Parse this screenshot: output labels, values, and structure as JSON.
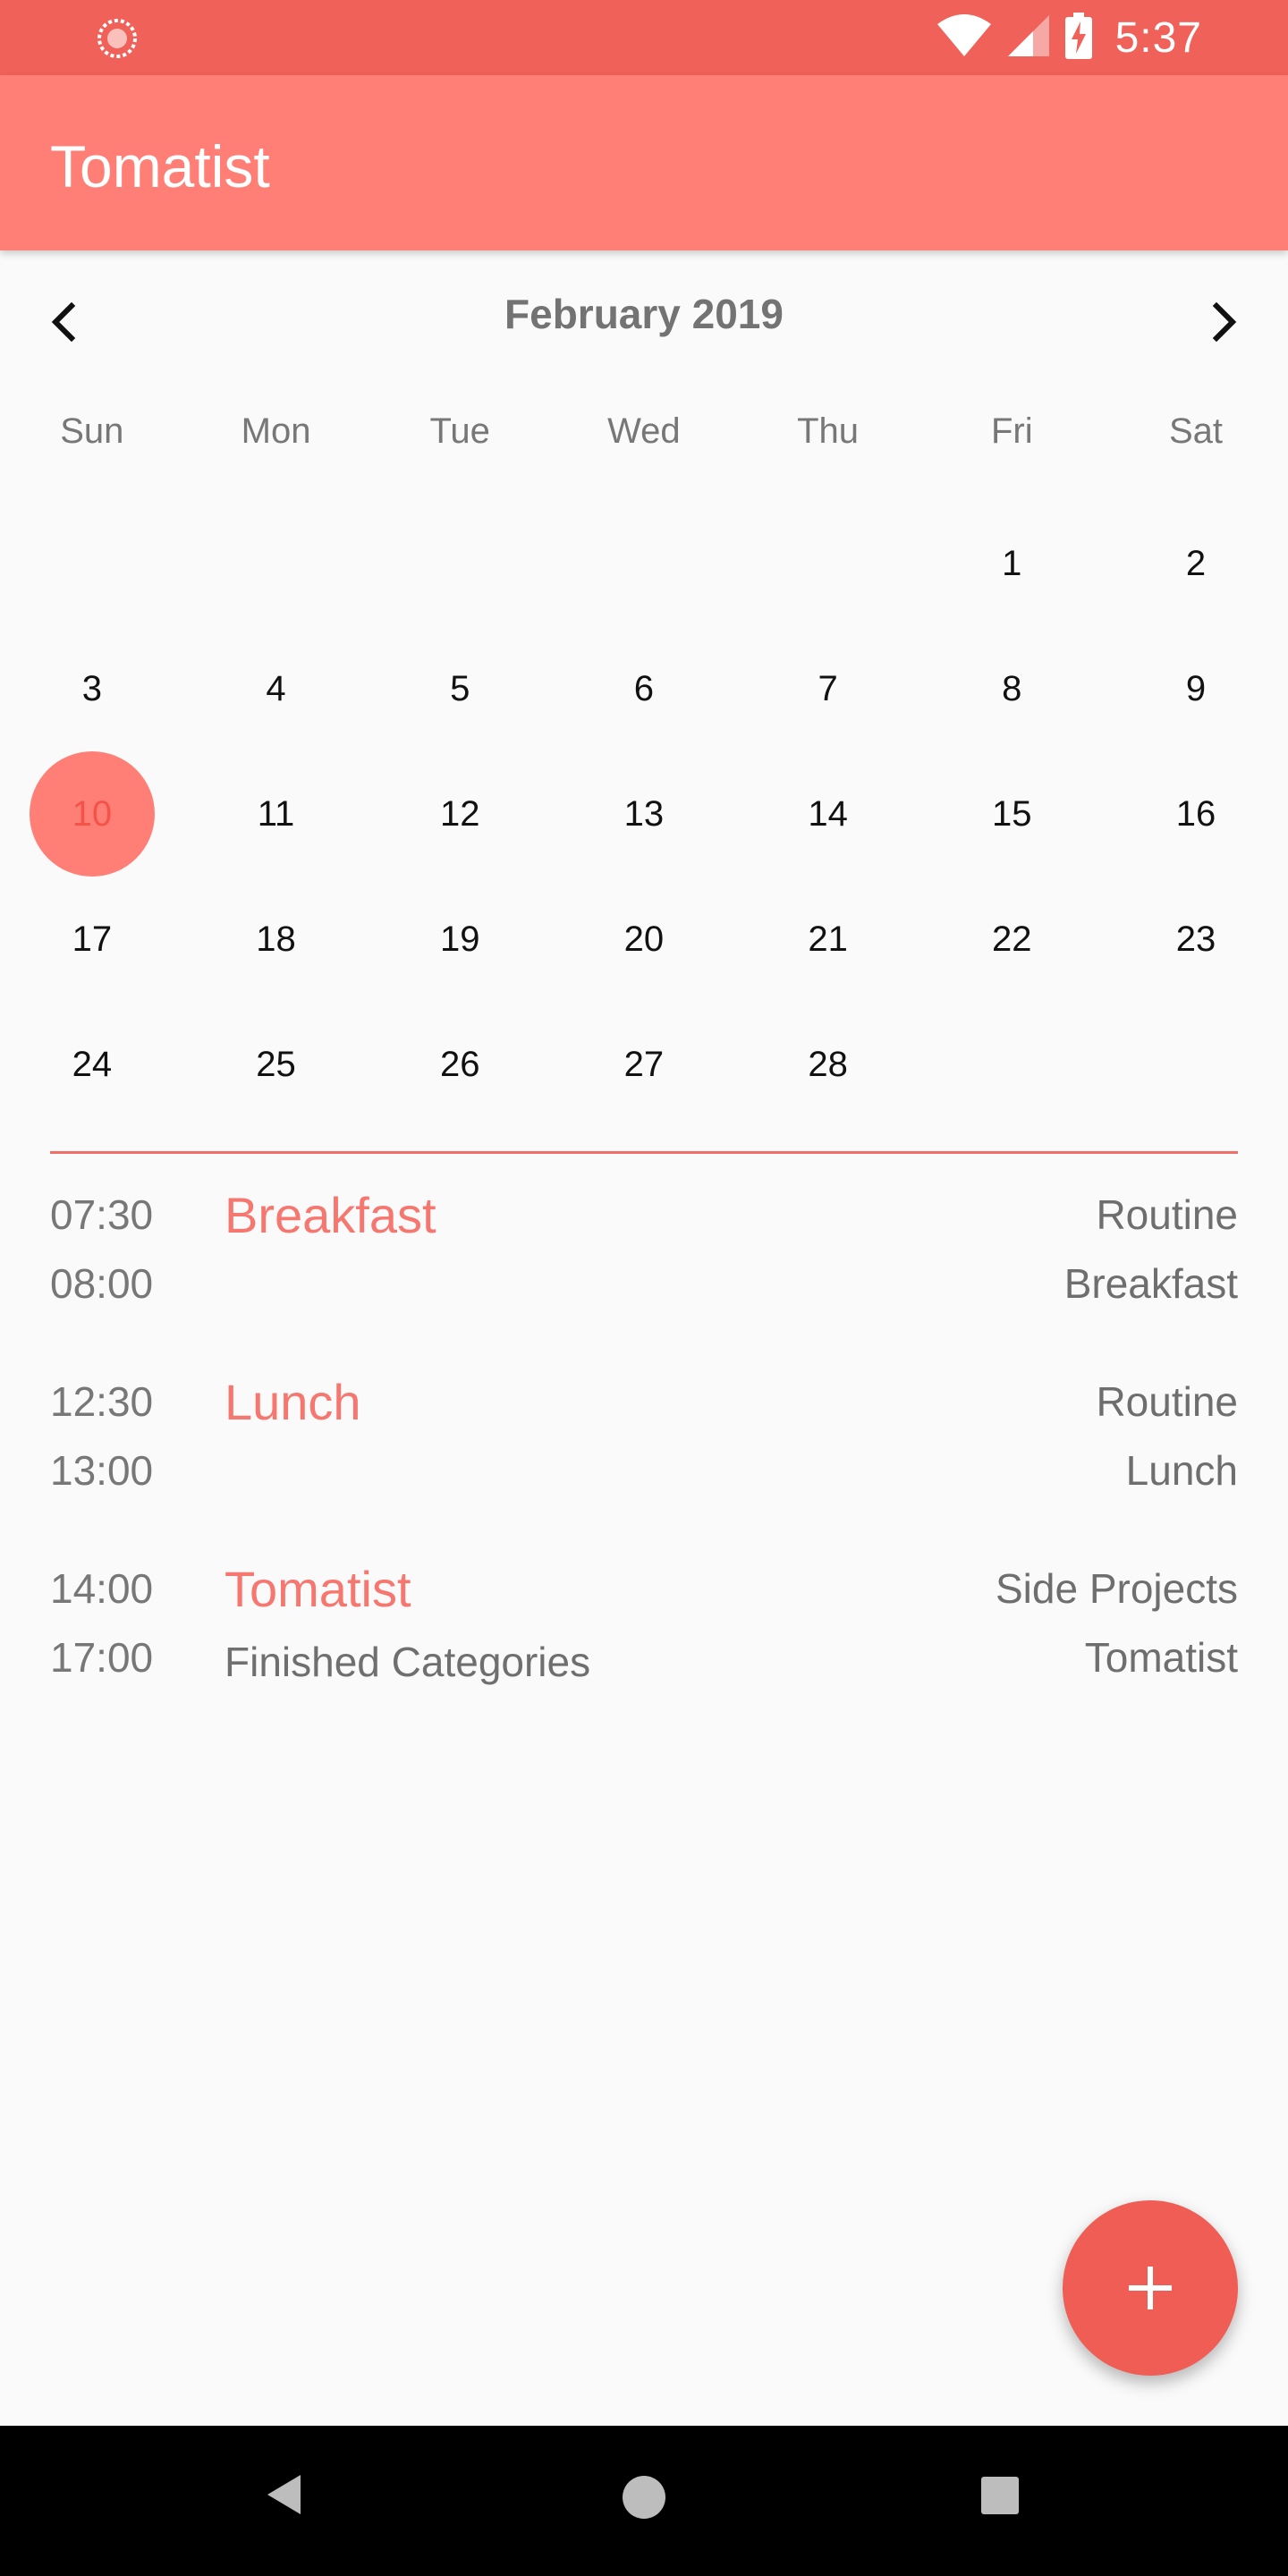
{
  "status_bar": {
    "time": "5:37",
    "icons": [
      "app-notification-icon",
      "wifi-icon",
      "cellular-signal-icon",
      "battery-charging-icon"
    ]
  },
  "app_bar": {
    "title": "Tomatist"
  },
  "calendar": {
    "month_title": "February 2019",
    "prev_icon": "chevron-left-icon",
    "next_icon": "chevron-right-icon",
    "weekdays": [
      "Sun",
      "Mon",
      "Tue",
      "Wed",
      "Thu",
      "Fri",
      "Sat"
    ],
    "days": [
      "",
      "",
      "",
      "",
      "",
      "1",
      "2",
      "3",
      "4",
      "5",
      "6",
      "7",
      "8",
      "9",
      "10",
      "11",
      "12",
      "13",
      "14",
      "15",
      "16",
      "17",
      "18",
      "19",
      "20",
      "21",
      "22",
      "23",
      "24",
      "25",
      "26",
      "27",
      "28",
      "",
      ""
    ],
    "selected_day": "10"
  },
  "events": [
    {
      "start": "07:30",
      "end": "08:00",
      "title": "Breakfast",
      "subtitle": "",
      "category": "Routine",
      "project": "Breakfast"
    },
    {
      "start": "12:30",
      "end": "13:00",
      "title": "Lunch",
      "subtitle": "",
      "category": "Routine",
      "project": "Lunch"
    },
    {
      "start": "14:00",
      "end": "17:00",
      "title": "Tomatist",
      "subtitle": "Finished Categories",
      "category": "Side Projects",
      "project": "Tomatist"
    }
  ],
  "fab": {
    "icon": "plus-icon"
  },
  "nav_bar": {
    "icons": [
      "back-icon",
      "home-icon",
      "recents-icon"
    ]
  },
  "colors": {
    "status_bar": "#ef6159",
    "app_bar": "#ff7f77",
    "accent": "#f6776f",
    "fab": "#ef5d55"
  }
}
